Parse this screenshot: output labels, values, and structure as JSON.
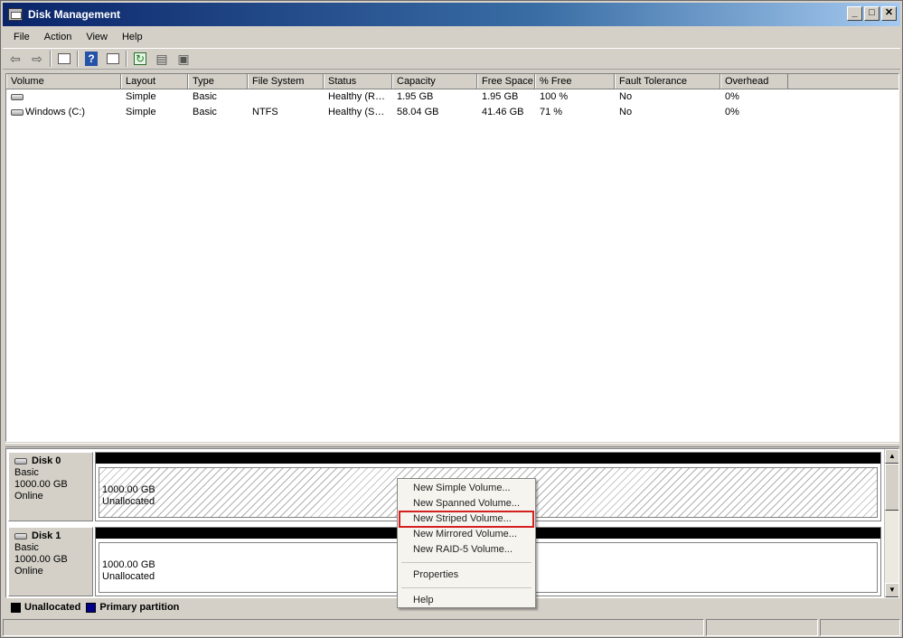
{
  "window": {
    "title": "Disk Management",
    "controls": {
      "minimize": "_",
      "maximize": "□",
      "close": "✕"
    }
  },
  "menu": [
    "File",
    "Action",
    "View",
    "Help"
  ],
  "toolbar": {
    "icons": [
      "back-arrow-icon",
      "forward-arrow-icon",
      "show-hide-console-tree-icon",
      "help-icon",
      "show-hide-action-pane-icon",
      "refresh-icon",
      "properties-icon",
      "rescan-icon"
    ]
  },
  "volume_list": {
    "columns": [
      "Volume",
      "Layout",
      "Type",
      "File System",
      "Status",
      "Capacity",
      "Free Space",
      "% Free",
      "Fault Tolerance",
      "Overhead"
    ],
    "rows": [
      [
        "",
        "Simple",
        "Basic",
        "",
        "Healthy (R…",
        "1.95 GB",
        "1.95 GB",
        "100 %",
        "No",
        "0%"
      ],
      [
        "Windows (C:)",
        "Simple",
        "Basic",
        "NTFS",
        "Healthy (S…",
        "58.04 GB",
        "41.46 GB",
        "71 %",
        "No",
        "0%"
      ]
    ]
  },
  "disks": [
    {
      "name": "Disk 0",
      "type": "Basic",
      "size": "1000.00 GB",
      "state": "Online",
      "partition_size": "1000.00 GB",
      "partition_label": "Unallocated"
    },
    {
      "name": "Disk 1",
      "type": "Basic",
      "size": "1000.00 GB",
      "state": "Online",
      "partition_size": "1000.00 GB",
      "partition_label": "Unallocated"
    }
  ],
  "legend": [
    {
      "label": "Unallocated",
      "color": "#000000"
    },
    {
      "label": "Primary partition",
      "color": "#00008b"
    }
  ],
  "context_menu": {
    "items": [
      "New Simple Volume...",
      "New Spanned Volume...",
      "New Striped Volume...",
      "New Mirrored Volume...",
      "New RAID-5 Volume..."
    ],
    "properties": "Properties",
    "help": "Help",
    "highlighted": "New Striped Volume..."
  },
  "colors": {
    "title_start": "#0a246a",
    "highlight_outline": "#d42020"
  }
}
